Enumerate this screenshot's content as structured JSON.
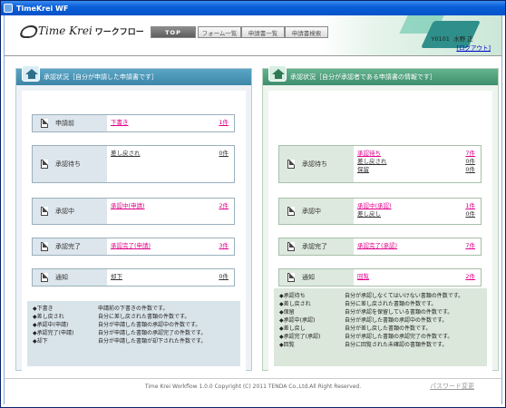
{
  "window": {
    "title": "TimeKrei WF"
  },
  "header": {
    "brand": "Time Krei",
    "brand_sub": "ワークフロー",
    "nav": [
      "TOP",
      "フォーム一覧",
      "申請書一覧",
      "申請書検索"
    ],
    "user_id": "Y0101",
    "user_name": "水野 正",
    "logout": "[ログアウト]"
  },
  "left_panel": {
    "title": "承認状況［自分が申請した申請書です］",
    "rows": [
      {
        "label": "申請前",
        "items": [
          {
            "text": "下書き",
            "count": "1件",
            "style": "pink"
          }
        ]
      },
      {
        "label": "承認待ち",
        "items": [
          {
            "text": "差し戻され",
            "count": "0件",
            "style": "dark"
          }
        ]
      },
      {
        "label": "承認中",
        "items": [
          {
            "text": "承認中(申請)",
            "count": "2件",
            "style": "pink"
          }
        ]
      },
      {
        "label": "承認完了",
        "items": [
          {
            "text": "承認完了(申請)",
            "count": "3件",
            "style": "pink"
          }
        ]
      },
      {
        "label": "通知",
        "items": [
          {
            "text": "却下",
            "count": "0件",
            "style": "dark"
          }
        ]
      }
    ],
    "legend": [
      [
        "◆下書き",
        "申請前の下書きの件数です。"
      ],
      [
        "◆差し戻され",
        "自分に差し戻された書類の件数です。"
      ],
      [
        "◆承認中(申請)",
        "自分が申請した書類の承認中の件数です。"
      ],
      [
        "◆承認完了(申請)",
        "自分が申請した書類の承認完了の件数です。"
      ],
      [
        "◆却下",
        "自分が申請した書類が却下された件数です。"
      ]
    ]
  },
  "right_panel": {
    "title": "承認状況［自分が承認者である申請書の情報です］",
    "rows": [
      {
        "label": "承認待ち",
        "items": [
          {
            "text": "承認待ち",
            "count": "7件",
            "style": "pink"
          },
          {
            "text": "差し戻され",
            "count": "0件",
            "style": "dark"
          },
          {
            "text": "保留",
            "count": "0件",
            "style": "dark"
          }
        ]
      },
      {
        "label": "承認中",
        "items": [
          {
            "text": "承認中(承認)",
            "count": "1件",
            "style": "pink"
          },
          {
            "text": "差し戻し",
            "count": "0件",
            "style": "dark"
          }
        ]
      },
      {
        "label": "承認完了",
        "items": [
          {
            "text": "承認完了(承認)",
            "count": "7件",
            "style": "pink"
          }
        ]
      },
      {
        "label": "通知",
        "items": [
          {
            "text": "回覧",
            "count": "2件",
            "style": "pink"
          }
        ]
      }
    ],
    "legend": [
      [
        "◆承認待ち",
        "自分が承認しなくてはいけない書類の件数です。"
      ],
      [
        "◆差し戻され",
        "自分に差し戻された書類の件数です。"
      ],
      [
        "◆保留",
        "自分が承認を保留している書類の件数です。"
      ],
      [
        "◆承認中(承認)",
        "自分が承認した書類の承認中の件数です。"
      ],
      [
        "◆差し戻し",
        "自分が差し戻した書類の件数です。"
      ],
      [
        "◆承認完了(承認)",
        "自分が承認した書類の承認完了の件数です。"
      ],
      [
        "◆回覧",
        "自分に回覧された未確認の書類件数です。"
      ]
    ]
  },
  "footer": {
    "copyright": "Time Krei Workflow 1.0.0 Copyright (C) 2011 TENDA Co.,Ltd.All Right Reserved.",
    "password_link": "パスワード変更"
  }
}
